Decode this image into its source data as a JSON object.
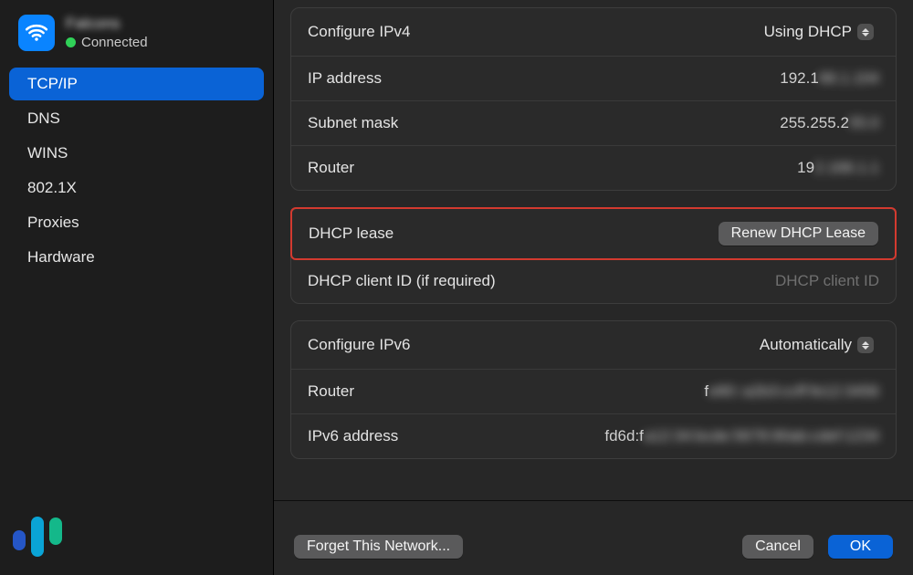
{
  "network": {
    "name": "Falcons",
    "status_text": "Connected"
  },
  "sidebar": {
    "items": [
      {
        "id": "tcpip",
        "label": "TCP/IP",
        "active": true
      },
      {
        "id": "dns",
        "label": "DNS",
        "active": false
      },
      {
        "id": "wins",
        "label": "WINS",
        "active": false
      },
      {
        "id": "8021x",
        "label": "802.1X",
        "active": false
      },
      {
        "id": "proxies",
        "label": "Proxies",
        "active": false
      },
      {
        "id": "hardware",
        "label": "Hardware",
        "active": false
      }
    ]
  },
  "ipv4": {
    "configure_label": "Configure IPv4",
    "configure_value": "Using DHCP",
    "ip_label": "IP address",
    "ip_value_visible": "192.1",
    "ip_value_hidden": "68.1.104",
    "subnet_label": "Subnet mask",
    "subnet_value_visible": "255.255.2",
    "subnet_value_hidden": "55.0",
    "router_label": "Router",
    "router_value_visible": "19",
    "router_value_hidden": "2.168.1.1"
  },
  "dhcp": {
    "lease_label": "DHCP lease",
    "renew_btn": "Renew DHCP Lease",
    "client_id_label": "DHCP client ID (if required)",
    "client_id_placeholder": "DHCP client ID"
  },
  "ipv6": {
    "configure_label": "Configure IPv6",
    "configure_value": "Automatically",
    "router_label": "Router",
    "router_value_visible": "f",
    "router_value_hidden": "e80::a2b3:ccff:fe12:3456",
    "addr_label": "IPv6 address",
    "addr_value_visible": "fd6d:f",
    "addr_value_hidden": "a12:34:bcde:5678:90ab:cdef:1234"
  },
  "footer": {
    "forget": "Forget This Network...",
    "cancel": "Cancel",
    "ok": "OK"
  }
}
